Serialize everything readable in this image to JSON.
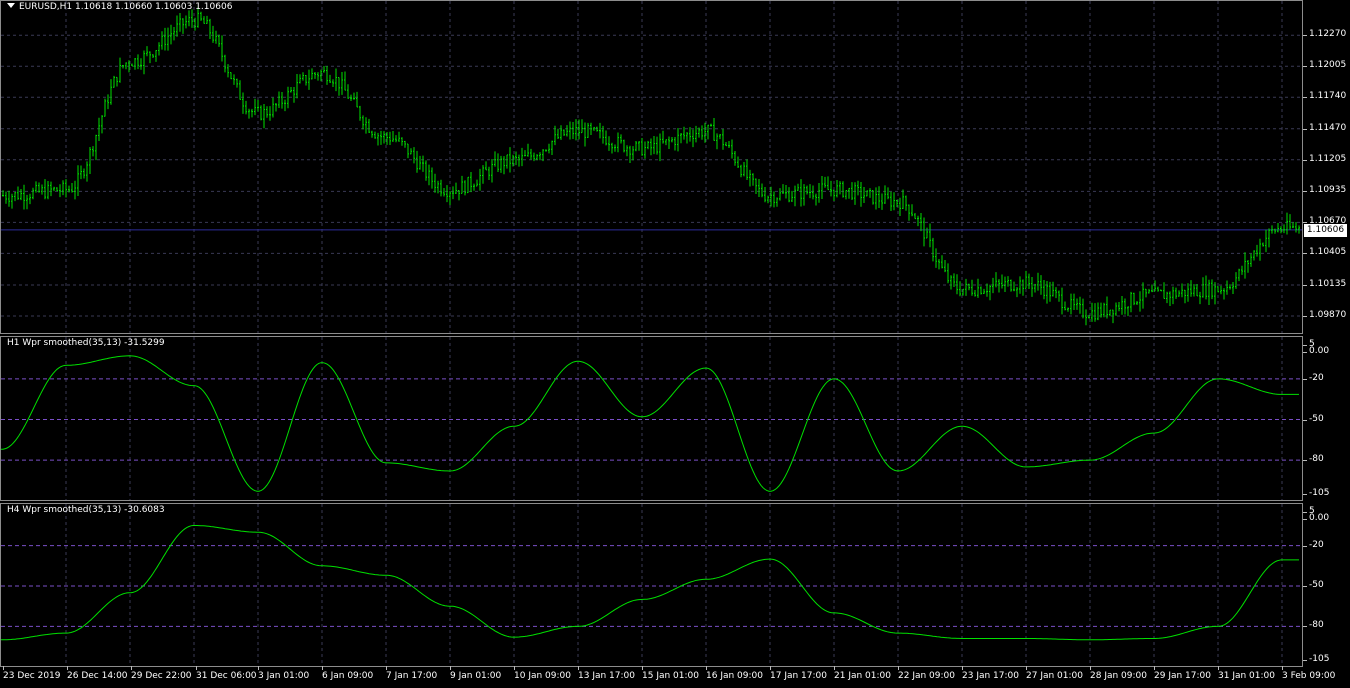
{
  "colors": {
    "background": "#000000",
    "candle": "#00e000",
    "indicator": "#00e000",
    "grid": "#3a3a55",
    "level": "#7a4fc7",
    "axis_border": "#8c8c8c"
  },
  "main_chart": {
    "label": "EURUSD,H1  1.10618 1.10660 1.10603 1.10606",
    "current_price": "1.10606",
    "y_ticks": [
      "1.12270",
      "1.12005",
      "1.11740",
      "1.11470",
      "1.11205",
      "1.10935",
      "1.10670",
      "1.10405",
      "1.10135",
      "1.09870"
    ]
  },
  "indicator_h1": {
    "label": "H1 Wpr smoothed(35,13) -31.5299",
    "y_ticks": [
      "5",
      "0.00",
      "-20",
      "-50",
      "-80",
      "-105"
    ],
    "levels": [
      -20,
      -50,
      -80
    ]
  },
  "indicator_h4": {
    "label": "H4 Wpr smoothed(35,13) -30.6083",
    "y_ticks": [
      "5",
      "0.00",
      "-20",
      "-50",
      "-80",
      "-105"
    ],
    "levels": [
      -20,
      -50,
      -80
    ]
  },
  "x_axis": {
    "labels": [
      "23 Dec 2019",
      "26 Dec 14:00",
      "29 Dec 22:00",
      "31 Dec 06:00",
      "3 Jan 01:00",
      "6 Jan 09:00",
      "7 Jan 17:00",
      "9 Jan 01:00",
      "10 Jan 09:00",
      "13 Jan 17:00",
      "15 Jan 01:00",
      "16 Jan 09:00",
      "17 Jan 17:00",
      "21 Jan 01:00",
      "22 Jan 09:00",
      "23 Jan 17:00",
      "27 Jan 01:00",
      "28 Jan 09:00",
      "29 Jan 17:00",
      "31 Jan 01:00",
      "3 Feb 09:00"
    ]
  },
  "chart_data": [
    {
      "type": "candlestick",
      "title": "EURUSD,H1",
      "ohlc_last": {
        "open": 1.10618,
        "high": 1.1066,
        "low": 1.10603,
        "close": 1.10606
      },
      "x": [
        "23 Dec 2019",
        "26 Dec 14:00",
        "29 Dec 22:00",
        "31 Dec 06:00",
        "3 Jan 01:00",
        "6 Jan 09:00",
        "7 Jan 17:00",
        "9 Jan 01:00",
        "10 Jan 09:00",
        "13 Jan 17:00",
        "15 Jan 01:00",
        "16 Jan 09:00",
        "17 Jan 17:00",
        "21 Jan 01:00",
        "22 Jan 09:00",
        "23 Jan 17:00",
        "27 Jan 01:00",
        "28 Jan 09:00",
        "29 Jan 17:00",
        "31 Jan 01:00",
        "3 Feb 09:00"
      ],
      "close_approx": [
        1.109,
        1.1095,
        1.1205,
        1.124,
        1.116,
        1.1195,
        1.114,
        1.1095,
        1.112,
        1.1145,
        1.113,
        1.1145,
        1.109,
        1.1095,
        1.1085,
        1.101,
        1.1015,
        1.099,
        1.1005,
        1.101,
        1.1062
      ],
      "ylim": [
        1.0975,
        1.124
      ],
      "grid": true
    },
    {
      "type": "line",
      "title": "H1 Wpr smoothed(35,13) -31.5299",
      "x": [
        "23 Dec 2019",
        "26 Dec 14:00",
        "29 Dec 22:00",
        "31 Dec 06:00",
        "3 Jan 01:00",
        "6 Jan 09:00",
        "7 Jan 17:00",
        "9 Jan 01:00",
        "10 Jan 09:00",
        "13 Jan 17:00",
        "15 Jan 01:00",
        "16 Jan 09:00",
        "17 Jan 17:00",
        "21 Jan 01:00",
        "22 Jan 09:00",
        "23 Jan 17:00",
        "27 Jan 01:00",
        "28 Jan 09:00",
        "29 Jan 17:00",
        "31 Jan 01:00",
        "3 Feb 09:00"
      ],
      "values": [
        -72,
        -10,
        -3,
        -25,
        -103,
        -8,
        -82,
        -88,
        -55,
        -7,
        -48,
        -12,
        -103,
        -20,
        -88,
        -55,
        -85,
        -80,
        -60,
        -20,
        -31.5
      ],
      "ylim": [
        -105,
        5
      ],
      "levels": [
        -20,
        -50,
        -80
      ]
    },
    {
      "type": "line",
      "title": "H4 Wpr smoothed(35,13) -30.6083",
      "x": [
        "23 Dec 2019",
        "26 Dec 14:00",
        "29 Dec 22:00",
        "31 Dec 06:00",
        "3 Jan 01:00",
        "6 Jan 09:00",
        "7 Jan 17:00",
        "9 Jan 01:00",
        "10 Jan 09:00",
        "13 Jan 17:00",
        "15 Jan 01:00",
        "16 Jan 09:00",
        "17 Jan 17:00",
        "21 Jan 01:00",
        "22 Jan 09:00",
        "23 Jan 17:00",
        "27 Jan 01:00",
        "28 Jan 09:00",
        "29 Jan 17:00",
        "31 Jan 01:00",
        "3 Feb 09:00"
      ],
      "values": [
        -90,
        -85,
        -55,
        -5,
        -10,
        -35,
        -42,
        -65,
        -88,
        -80,
        -60,
        -45,
        -30,
        -70,
        -85,
        -89,
        -89,
        -90,
        -89,
        -80,
        -30.6
      ],
      "ylim": [
        -105,
        5
      ],
      "levels": [
        -20,
        -50,
        -80
      ]
    }
  ]
}
